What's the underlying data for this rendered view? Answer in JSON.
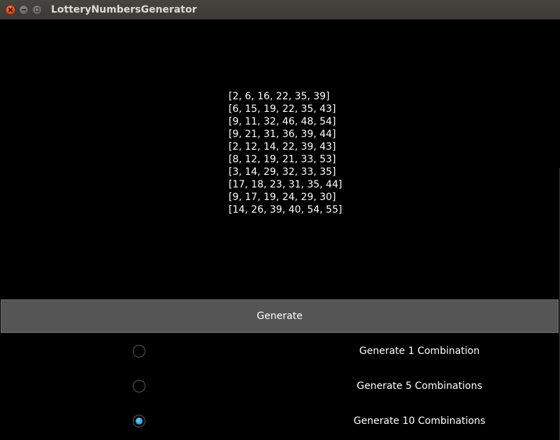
{
  "window": {
    "title": "LotteryNumbersGenerator"
  },
  "results": [
    "[2, 6, 16, 22, 35, 39]",
    "[6, 15, 19, 22, 35, 43]",
    "[9, 11, 32, 46, 48, 54]",
    "[9, 21, 31, 36, 39, 44]",
    "[2, 12, 14, 22, 39, 43]",
    "[8, 12, 19, 21, 33, 53]",
    "[3, 14, 29, 32, 33, 35]",
    "[17, 18, 23, 31, 35, 44]",
    "[9, 17, 19, 24, 29, 30]",
    "[14, 26, 39, 40, 54, 55]"
  ],
  "generate_button": {
    "label": "Generate"
  },
  "options": [
    {
      "label": "Generate 1 Combination",
      "selected": false
    },
    {
      "label": "Generate 5 Combinations",
      "selected": false
    },
    {
      "label": "Generate 10 Combinations",
      "selected": true
    }
  ],
  "colors": {
    "background": "#000000",
    "button": "#555555",
    "radio_accent": "#2aa3e0",
    "text": "#ffffff"
  },
  "icons": {
    "close": "close-icon",
    "minimize": "minimize-icon",
    "maximize": "maximize-icon"
  }
}
